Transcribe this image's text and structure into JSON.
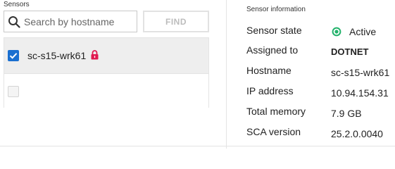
{
  "sensors_panel": {
    "section_label": "Sensors",
    "search": {
      "placeholder": "Search by hostname",
      "value": ""
    },
    "find_label": "FIND",
    "rows": [
      {
        "hostname": "sc-s15-wrk61",
        "checked": true,
        "locked": true
      },
      {
        "hostname": "",
        "checked": false,
        "locked": false
      }
    ]
  },
  "sensor_info": {
    "title": "Sensor information",
    "state_label": "Sensor state",
    "state_value": "Active",
    "assigned_label": "Assigned to",
    "assigned_value": "DOTNET",
    "hostname_label": "Hostname",
    "hostname_value": "sc-s15-wrk61",
    "ip_label": "IP address",
    "ip_value": "10.94.154.31",
    "memory_label": "Total memory",
    "memory_value": "7.9 GB",
    "sca_label": "SCA version",
    "sca_value": "25.2.0.0040"
  },
  "colors": {
    "accent": "#1a6fd0",
    "active_status": "#22b26b",
    "lock": "#e0184f"
  }
}
